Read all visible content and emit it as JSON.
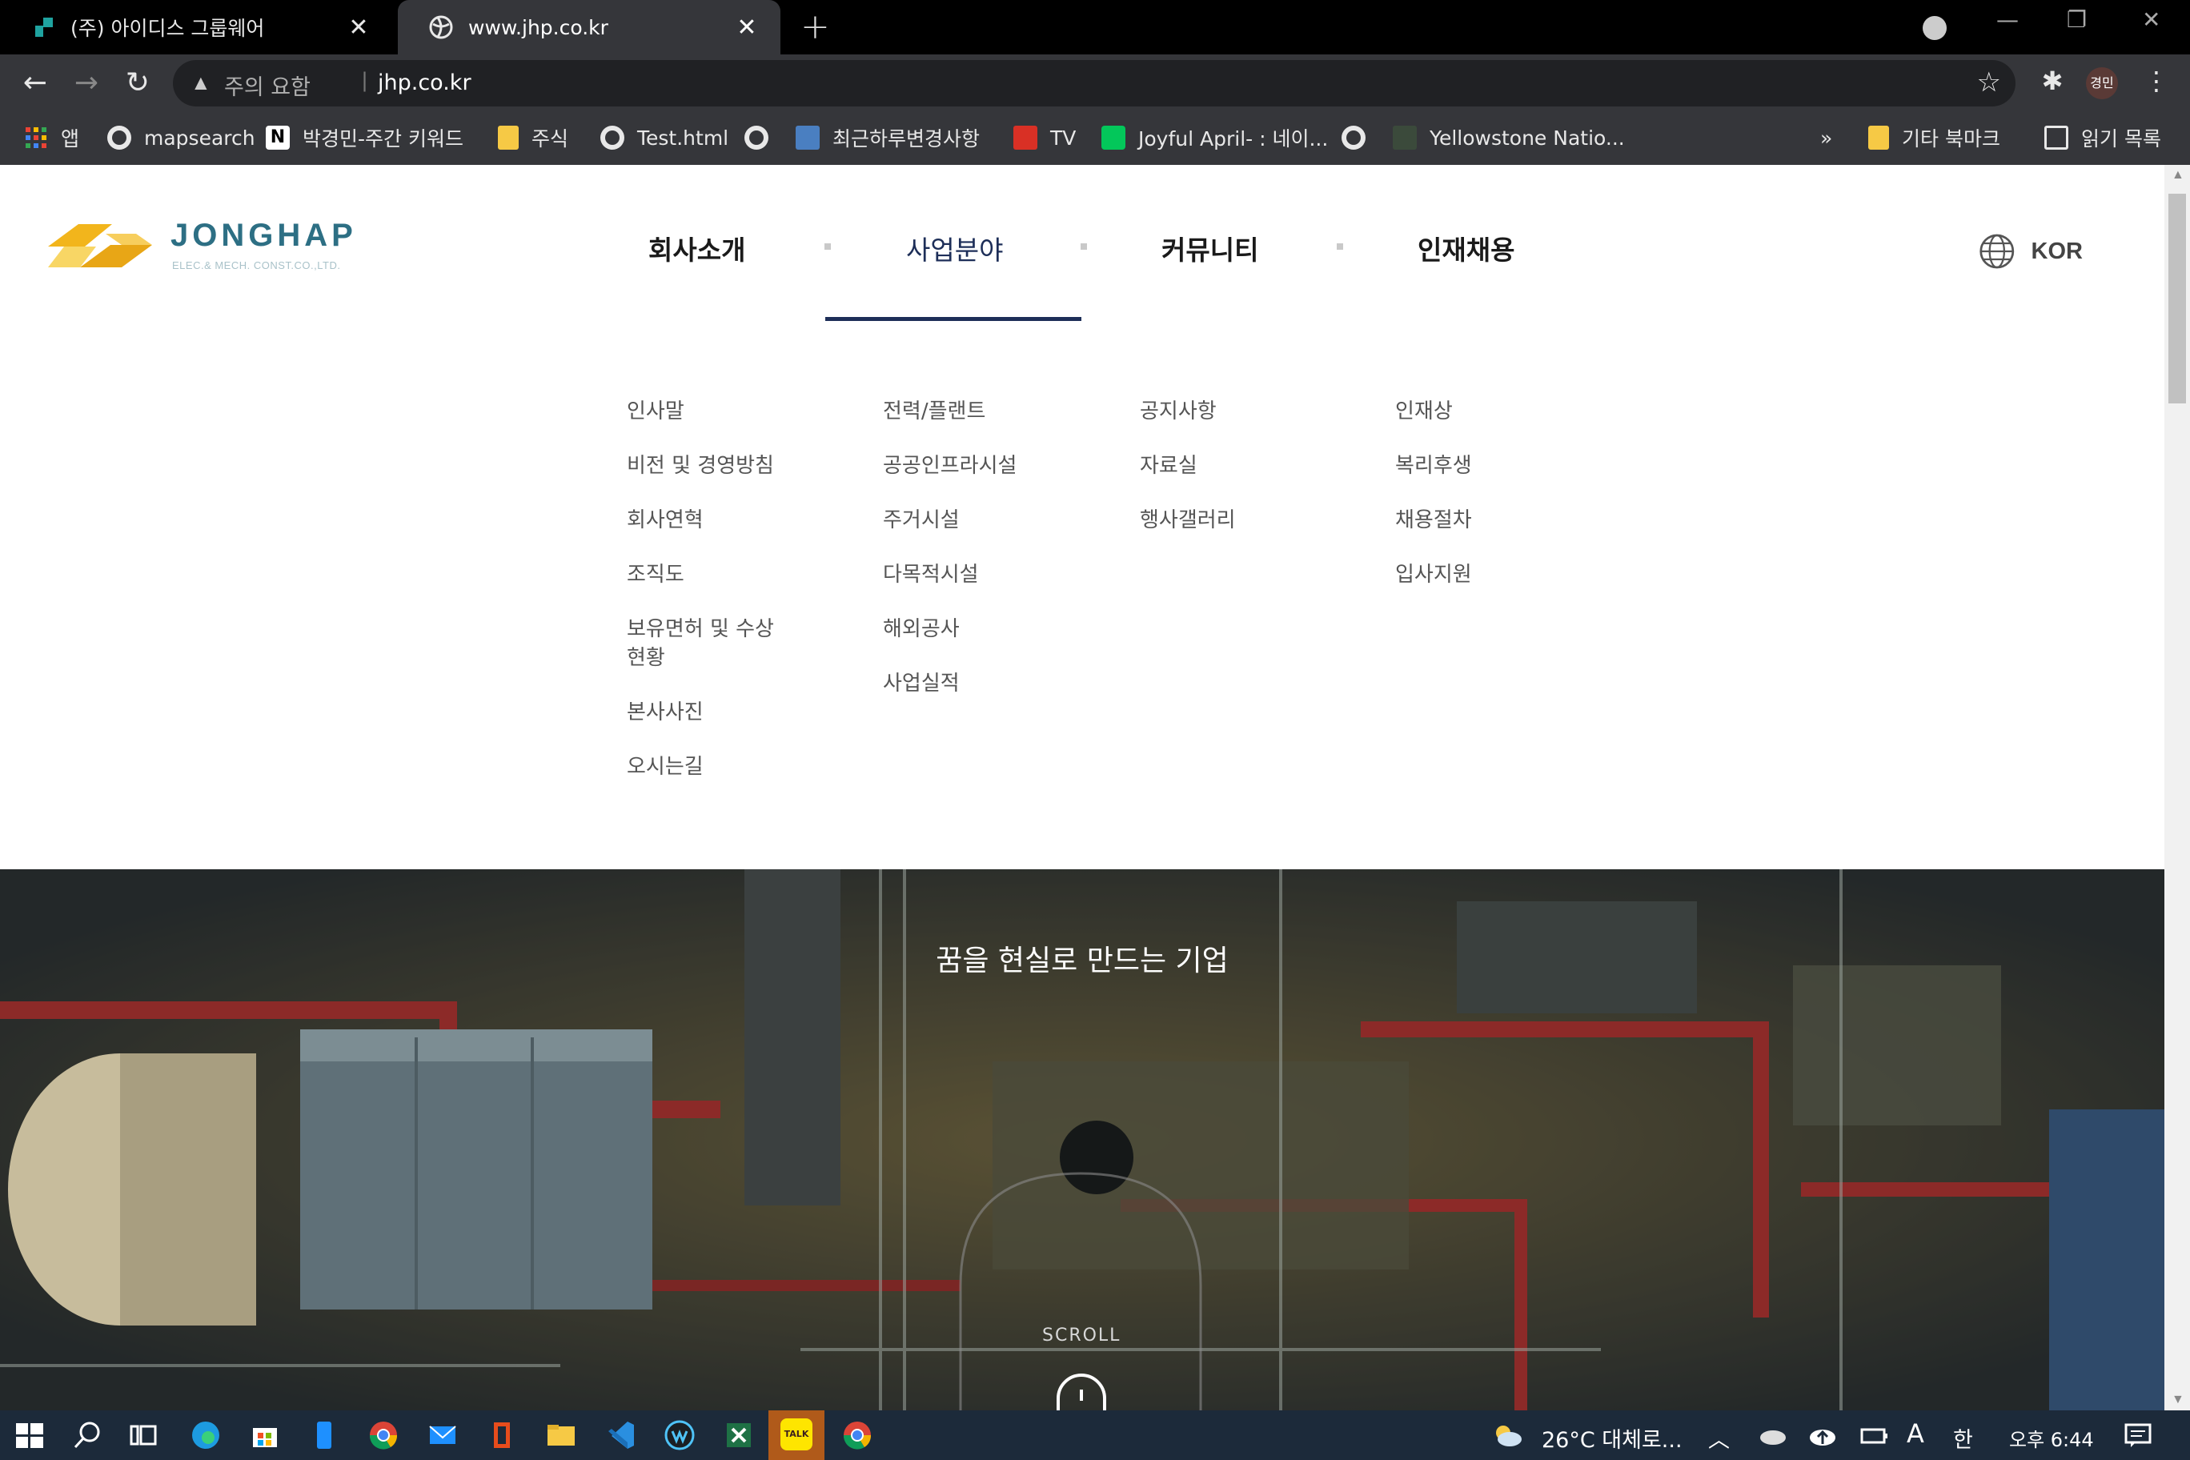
{
  "browser": {
    "tabs": [
      {
        "title": "(주) 아이디스 그룹웨어",
        "close": "✕"
      },
      {
        "title": "www.jhp.co.kr",
        "close": "✕"
      }
    ],
    "new_tab": "+",
    "window_controls": {
      "minimize": "—",
      "restore": "❐",
      "close": "✕"
    },
    "address": {
      "security": "주의 요함",
      "separator": "|",
      "url": "jhp.co.kr"
    },
    "profile": "경민",
    "bookmarks": [
      {
        "label": "앱",
        "icon": "apps-grid-icon"
      },
      {
        "label": "mapsearch",
        "icon": "globe-icon"
      },
      {
        "label": "박경민-주간 키워드",
        "icon": "notion-icon"
      },
      {
        "label": "주식",
        "icon": "folder-icon"
      },
      {
        "label": "Test.html",
        "icon": "globe-icon"
      },
      {
        "label": "",
        "icon": "globe-icon"
      },
      {
        "label": "최근하루변경사항",
        "icon": "list-icon"
      },
      {
        "label": "TV",
        "icon": "tv-icon"
      },
      {
        "label": "Joyful April- : 네이...",
        "icon": "blog-icon"
      },
      {
        "label": "",
        "icon": "globe-icon"
      },
      {
        "label": "Yellowstone Natio...",
        "icon": "nps-icon"
      }
    ],
    "bookmarks_overflow": "»",
    "other_bookmarks": "기타 북마크",
    "reading_list": "읽기 목록"
  },
  "site": {
    "logo": {
      "word": "JONGHAP",
      "sub": "ELEC.& MECH. CONST.CO.,LTD."
    },
    "gnb": [
      {
        "label": "회사소개",
        "active": false
      },
      {
        "label": "사업분야",
        "active": true
      },
      {
        "label": "커뮤니티",
        "active": false
      },
      {
        "label": "인재채용",
        "active": false
      }
    ],
    "lang": "KOR",
    "submenus": [
      [
        "인사말",
        "비전 및 경영방침",
        "회사연혁",
        "조직도",
        "보유면허 및 수상현황",
        "본사사진",
        "오시는길"
      ],
      [
        "전력/플랜트",
        "공공인프라시설",
        "주거시설",
        "다목적시설",
        "해외공사",
        "사업실적"
      ],
      [
        "공지사항",
        "자료실",
        "행사갤러리"
      ],
      [
        "인재상",
        "복리후생",
        "채용절차",
        "입사지원"
      ]
    ],
    "hero": {
      "title": "꿈을 현실로 만드는 기업",
      "scroll": "SCROLL"
    }
  },
  "taskbar": {
    "weather": "26°C 대체로...",
    "ime": "A",
    "ime2": "한",
    "time": "오후 6:44"
  },
  "colors": {
    "brand": "#2d6f84",
    "nav_active": "#1d2e58",
    "chrome_bg": "#35363a"
  }
}
